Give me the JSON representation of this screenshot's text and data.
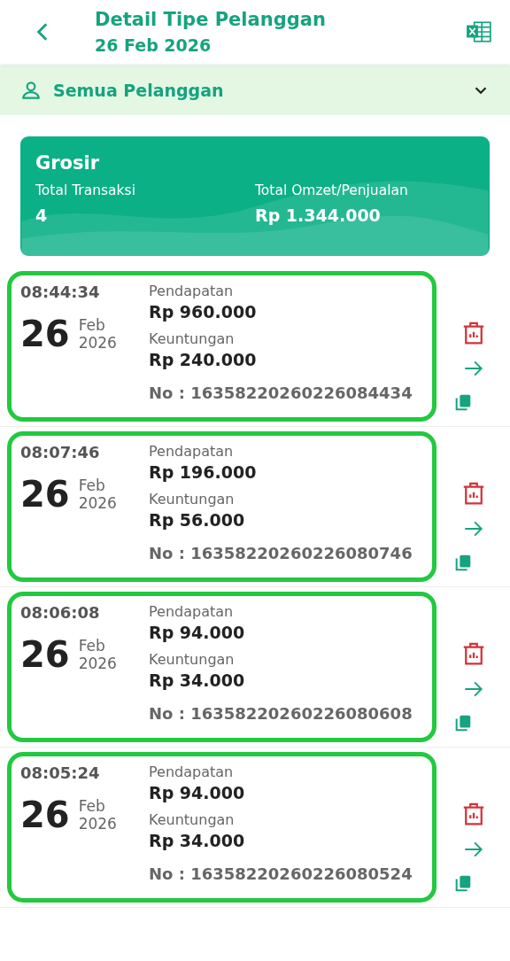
{
  "header": {
    "title": "Detail Tipe Pelanggan",
    "subtitle": "26 Feb 2026"
  },
  "filter": {
    "label": "Semua Pelanggan"
  },
  "summary": {
    "title": "Grosir",
    "stats": [
      {
        "label": "Total Transaksi",
        "value": "4"
      },
      {
        "label": "Total Omzet/Penjualan",
        "value": "Rp 1.344.000"
      }
    ]
  },
  "transactions": [
    {
      "time": "08:44:34",
      "day": "26",
      "month": "Feb",
      "year": "2026",
      "income_label": "Pendapatan",
      "income": "Rp 960.000",
      "profit_label": "Keuntungan",
      "profit": "Rp 240.000",
      "number": "No : 16358220260226084434"
    },
    {
      "time": "08:07:46",
      "day": "26",
      "month": "Feb",
      "year": "2026",
      "income_label": "Pendapatan",
      "income": "Rp 196.000",
      "profit_label": "Keuntungan",
      "profit": "Rp 56.000",
      "number": "No : 16358220260226080746"
    },
    {
      "time": "08:06:08",
      "day": "26",
      "month": "Feb",
      "year": "2026",
      "income_label": "Pendapatan",
      "income": "Rp 94.000",
      "profit_label": "Keuntungan",
      "profit": "Rp 34.000",
      "number": "No : 16358220260226080608"
    },
    {
      "time": "08:05:24",
      "day": "26",
      "month": "Feb",
      "year": "2026",
      "income_label": "Pendapatan",
      "income": "Rp 94.000",
      "profit_label": "Keuntungan",
      "profit": "Rp 34.000",
      "number": "No : 16358220260226080524"
    }
  ]
}
